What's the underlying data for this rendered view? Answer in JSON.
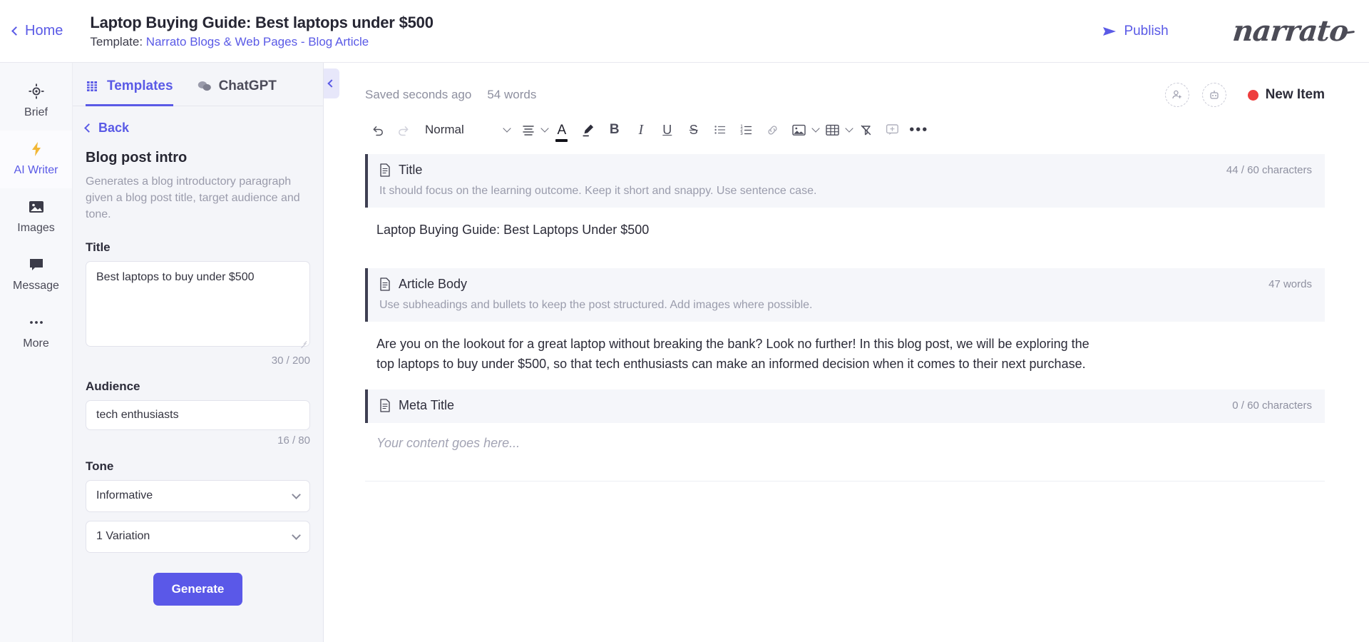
{
  "topbar": {
    "home_label": "Home",
    "doc_title": "Laptop Buying Guide: Best laptops under $500",
    "template_prefix": "Template: ",
    "template_name": "Narrato Blogs & Web Pages - Blog Article",
    "publish_label": "Publish",
    "brand": "narrato"
  },
  "rail": {
    "items": [
      {
        "label": "Brief",
        "icon": "target-icon",
        "active": false
      },
      {
        "label": "AI Writer",
        "icon": "lightning-icon",
        "active": true
      },
      {
        "label": "Images",
        "icon": "image-icon",
        "active": false
      },
      {
        "label": "Message",
        "icon": "message-icon",
        "active": false
      },
      {
        "label": "More",
        "icon": "ellipsis-icon",
        "active": false
      }
    ]
  },
  "panel": {
    "tabs": [
      {
        "label": "Templates",
        "icon": "templates-icon",
        "active": true
      },
      {
        "label": "ChatGPT",
        "icon": "chat-bubbles-icon",
        "active": false
      }
    ],
    "back_label": "Back",
    "template_name": "Blog post intro",
    "template_desc": "Generates a blog introductory paragraph given a blog post title, target audience and tone.",
    "fields": {
      "title_label": "Title",
      "title_value": "Best laptops to buy under $500",
      "title_counter": "30 / 200",
      "audience_label": "Audience",
      "audience_value": "tech enthusiasts",
      "audience_counter": "16 / 80",
      "tone_label": "Tone",
      "tone_value": "Informative",
      "variation_value": "1 Variation"
    },
    "generate_label": "Generate"
  },
  "editor": {
    "status": {
      "saved_text": "Saved seconds ago",
      "word_count": "54 words",
      "new_item_label": "New Item",
      "new_item_dot_color": "#ee3d3d"
    },
    "toolbar": {
      "undo": "undo-icon",
      "redo": "redo-icon",
      "style_label": "Normal",
      "align": "align-icon",
      "text_color": "A",
      "highlight": "highlighter-icon",
      "bold": "B",
      "italic": "I",
      "underline": "U",
      "strike": "S",
      "bullet_list": "bullet-list-icon",
      "numbered_list": "numbered-list-icon",
      "link": "link-icon",
      "image": "image-icon",
      "table": "table-icon",
      "clear_format": "clear-format-icon",
      "comment": "comment-icon",
      "more": "•••"
    },
    "blocks": [
      {
        "title": "Title",
        "meta": "44 / 60 characters",
        "hint": "It should focus on the learning outcome. Keep it short and snappy. Use sentence case.",
        "body": "Laptop Buying Guide: Best Laptops Under $500",
        "is_placeholder": false
      },
      {
        "title": "Article Body",
        "meta": "47 words",
        "hint": "Use subheadings and bullets to keep the post structured. Add images where possible.",
        "body": "Are you on the lookout for a great laptop without breaking the bank? Look no further! In this blog post, we will be exploring the top laptops to buy under $500, so that tech enthusiasts can make an informed decision when it comes to their next purchase.",
        "is_placeholder": false
      },
      {
        "title": "Meta Title",
        "meta": "0 / 60 characters",
        "hint": "",
        "body": "Your content goes here...",
        "is_placeholder": true
      }
    ]
  },
  "colors": {
    "accent": "#5a5ae6",
    "generate_button": "#5a58e8",
    "panel_bg": "#f4f5f9",
    "block_bg": "#f5f6fa",
    "block_bar": "#3e3f52"
  }
}
